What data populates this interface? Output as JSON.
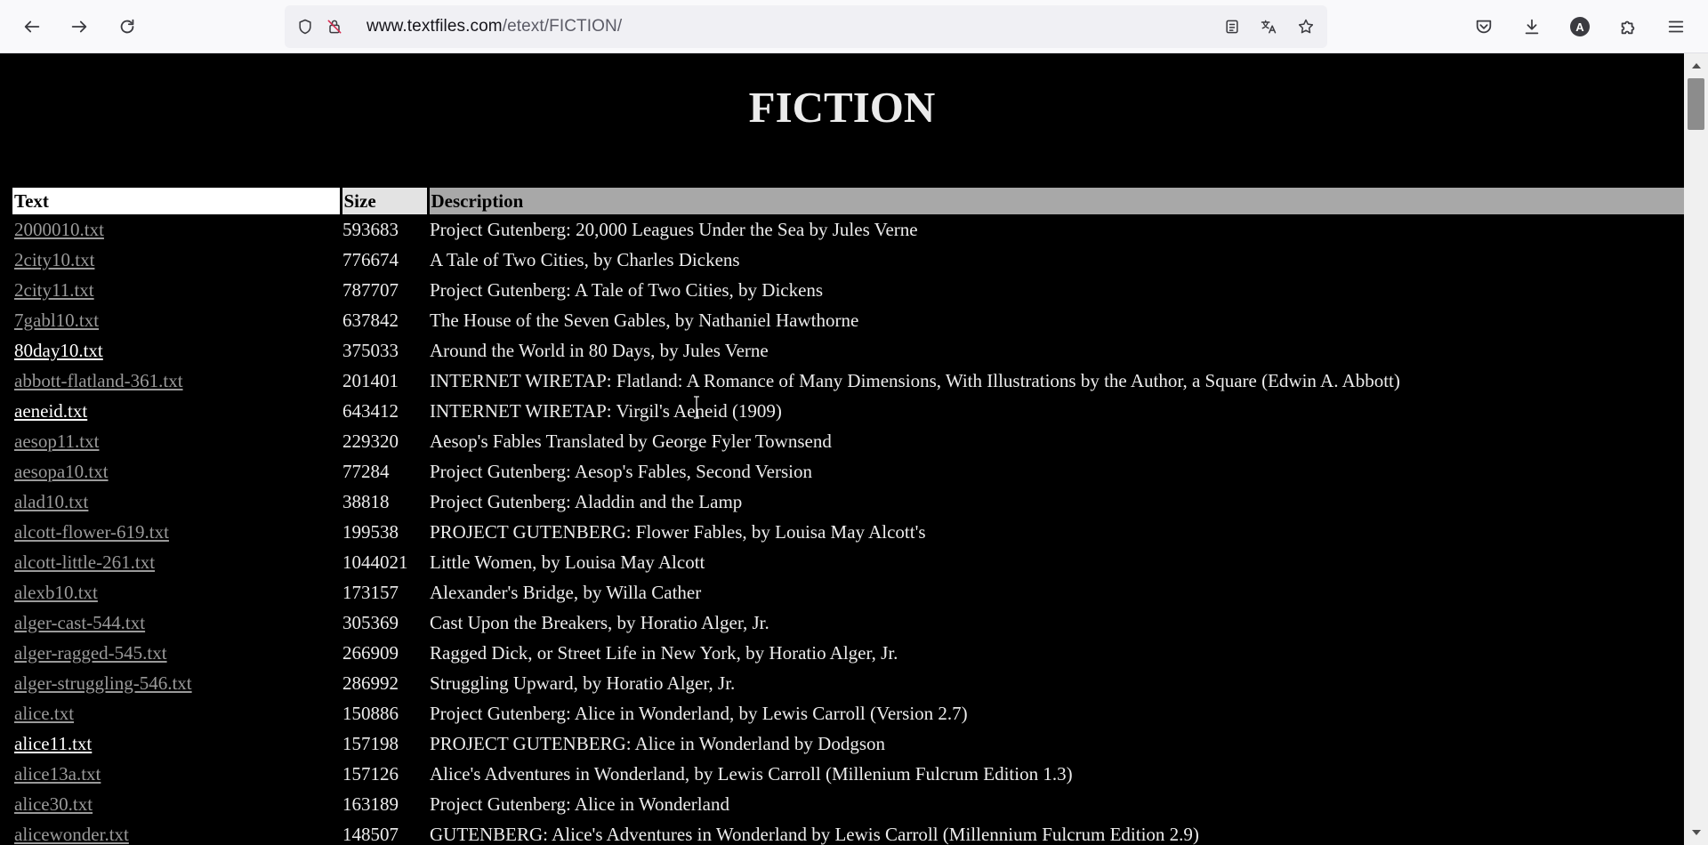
{
  "browser": {
    "url_host": "www.textfiles.com",
    "url_path": "/etext/FICTION/",
    "avatar_letter": "A"
  },
  "page": {
    "title": "FICTION",
    "columns": {
      "text": "Text",
      "size": "Size",
      "description": "Description"
    },
    "rows": [
      {
        "file": "2000010.txt",
        "size": "593683",
        "desc": "Project Gutenberg: 20,000 Leagues Under the Sea by Jules Verne",
        "visited": false
      },
      {
        "file": "2city10.txt",
        "size": "776674",
        "desc": "A Tale of Two Cities, by Charles Dickens",
        "visited": false
      },
      {
        "file": "2city11.txt",
        "size": "787707",
        "desc": "Project Gutenberg: A Tale of Two Cities, by Dickens",
        "visited": false
      },
      {
        "file": "7gabl10.txt",
        "size": "637842",
        "desc": "The House of the Seven Gables, by Nathaniel Hawthorne",
        "visited": false
      },
      {
        "file": "80day10.txt",
        "size": "375033",
        "desc": "Around the World in 80 Days, by Jules Verne",
        "visited": true
      },
      {
        "file": "abbott-flatland-361.txt",
        "size": "201401",
        "desc": "INTERNET WIRETAP: Flatland: A Romance of Many Dimensions, With Illustrations by the Author, a Square (Edwin A. Abbott)",
        "visited": false
      },
      {
        "file": "aeneid.txt",
        "size": "643412",
        "desc": "INTERNET WIRETAP: Virgil's Aeneid (1909)",
        "visited": true
      },
      {
        "file": "aesop11.txt",
        "size": "229320",
        "desc": "Aesop's Fables Translated by George Fyler Townsend",
        "visited": false
      },
      {
        "file": "aesopa10.txt",
        "size": "77284",
        "desc": "Project Gutenberg: Aesop's Fables, Second Version",
        "visited": false
      },
      {
        "file": "alad10.txt",
        "size": "38818",
        "desc": "Project Gutenberg: Aladdin and the Lamp",
        "visited": false
      },
      {
        "file": "alcott-flower-619.txt",
        "size": "199538",
        "desc": "PROJECT GUTENBERG: Flower Fables, by Louisa May Alcott's",
        "visited": false
      },
      {
        "file": "alcott-little-261.txt",
        "size": "1044021",
        "desc": "Little Women, by Louisa May Alcott",
        "visited": false
      },
      {
        "file": "alexb10.txt",
        "size": "173157",
        "desc": "Alexander's Bridge, by Willa Cather",
        "visited": false
      },
      {
        "file": "alger-cast-544.txt",
        "size": "305369",
        "desc": "Cast Upon the Breakers, by Horatio Alger, Jr.",
        "visited": false
      },
      {
        "file": "alger-ragged-545.txt",
        "size": "266909",
        "desc": "Ragged Dick, or Street Life in New York, by Horatio Alger, Jr.",
        "visited": false
      },
      {
        "file": "alger-struggling-546.txt",
        "size": "286992",
        "desc": "Struggling Upward, by Horatio Alger, Jr.",
        "visited": false
      },
      {
        "file": "alice.txt",
        "size": "150886",
        "desc": "Project Gutenberg: Alice in Wonderland, by Lewis Carroll (Version 2.7)",
        "visited": false
      },
      {
        "file": "alice11.txt",
        "size": "157198",
        "desc": "PROJECT GUTENBERG: Alice in Wonderland by Dodgson",
        "visited": true
      },
      {
        "file": "alice13a.txt",
        "size": "157126",
        "desc": "Alice's Adventures in Wonderland, by Lewis Carroll (Millenium Fulcrum Edition 1.3)",
        "visited": false
      },
      {
        "file": "alice30.txt",
        "size": "163189",
        "desc": "Project Gutenberg: Alice in Wonderland",
        "visited": false
      },
      {
        "file": "alicewonder.txt",
        "size": "148507",
        "desc": "GUTENBERG: Alice's Adventures in Wonderland by Lewis Carroll (Millennium Fulcrum Edition 2.9)",
        "visited": false
      }
    ]
  },
  "colors": {
    "page_background": "#000000",
    "link": "#9a9a9a",
    "link_visited": "#ffffff",
    "text": "#ececec"
  }
}
